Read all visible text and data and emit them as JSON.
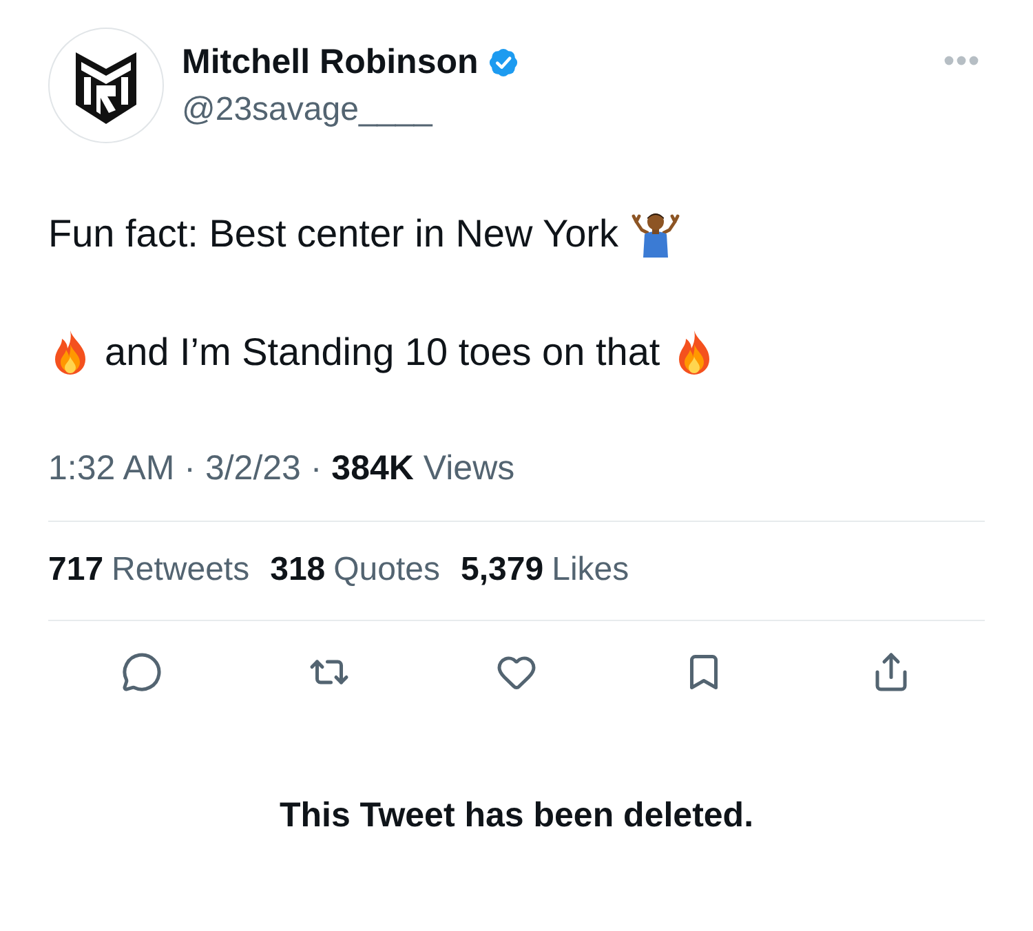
{
  "author": {
    "name": "Mitchell Robinson",
    "verified": true,
    "handle": "@23savage____"
  },
  "tweet": {
    "paragraphs": [
      "Fun fact: Best center in New York",
      "and I’m Standing 10 toes on that"
    ],
    "meta": "1:32 AM · 3/2/23 · **384K** Views"
  },
  "stats": [
    {
      "count": "717",
      "label": "Retweets"
    },
    {
      "count": "318",
      "label": "Quotes"
    },
    {
      "count": "5,379",
      "label": "Likes"
    }
  ],
  "deleted_notice": "This Tweet has been deleted."
}
